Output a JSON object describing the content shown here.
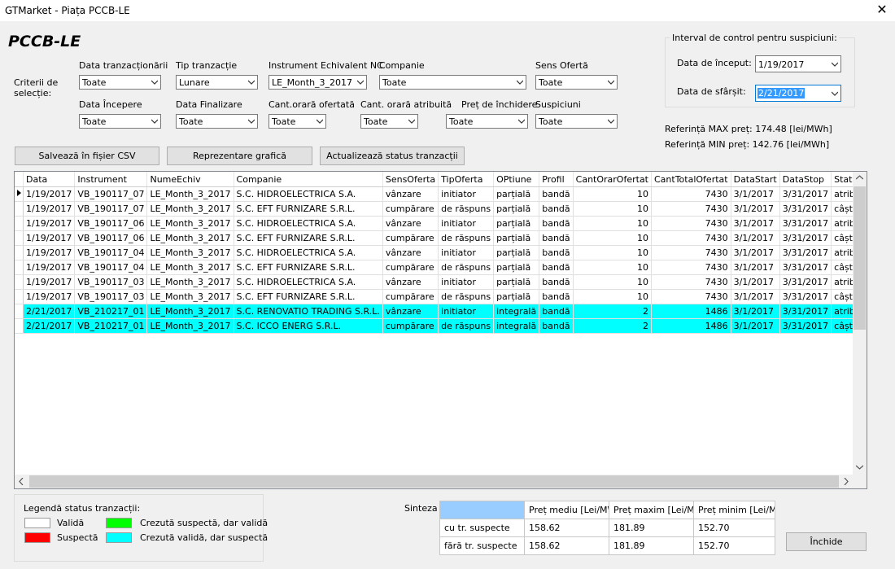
{
  "window": {
    "title": "GTMarket - Piața PCCB-LE",
    "close": "✕"
  },
  "app_title": "PCCB-LE",
  "criteria_label": "Criterii de selecție:",
  "filters": {
    "data_tranzactionarii": {
      "label": "Data tranzacționării",
      "value": "Toate"
    },
    "tip_tranzactie": {
      "label": "Tip tranzacție",
      "value": "Lunare"
    },
    "instrument": {
      "label": "Instrument Echivalent NC",
      "value": "LE_Month_3_2017"
    },
    "companie": {
      "label": "Companie",
      "value": "Toate"
    },
    "sens_oferta": {
      "label": "Sens Ofertă",
      "value": "Toate"
    },
    "data_incepere": {
      "label": "Data Începere",
      "value": "Toate"
    },
    "data_finalizare": {
      "label": "Data Finalizare",
      "value": "Toate"
    },
    "cant_orara_ofertata": {
      "label": "Cant.orară ofertată",
      "value": "Toate"
    },
    "cant_orara_atribuita": {
      "label": "Cant. orară atribuită",
      "value": "Toate"
    },
    "pret_inchidere": {
      "label": "Preț de închidere",
      "value": "Toate"
    },
    "suspiciuni": {
      "label": "Suspiciuni",
      "value": "Toate"
    }
  },
  "interval": {
    "title": "Interval de control pentru suspiciuni:",
    "start_label": "Data de început:",
    "start_value": "1/19/2017",
    "end_label": "Data de sfârșit:",
    "end_value": "2/21/2017"
  },
  "references": {
    "max": "Referință MAX preț: 174.48 [lei/MWh]",
    "min": "Referință MIN preț: 142.76 [lei/MWh]"
  },
  "buttons": {
    "save_csv": "Salvează în fișier CSV",
    "chart": "Reprezentare grafică",
    "update_status": "Actualizează status tranzacții",
    "close": "Închide"
  },
  "table": {
    "columns": [
      "Data",
      "Instrument",
      "NumeEchiv",
      "Companie",
      "SensOferta",
      "TipOferta",
      "OPtiune",
      "Profil",
      "CantOrarOfertat",
      "CantTotalOfertat",
      "DataStart",
      "DataStop",
      "StatusOferta"
    ],
    "rows": [
      [
        "1/19/2017",
        "VB_190117_07",
        "LE_Month_3_2017",
        "S.C. HIDROELECTRICA S.A.",
        "vânzare",
        "initiator",
        "parțială",
        "bandă",
        "10",
        "7430",
        "3/1/2017",
        "3/31/2017",
        "atribuită integral"
      ],
      [
        "1/19/2017",
        "VB_190117_07",
        "LE_Month_3_2017",
        "S.C. EFT FURNIZARE S.R.L.",
        "cumpărare",
        "de răspuns",
        "parțială",
        "bandă",
        "10",
        "7430",
        "3/1/2017",
        "3/31/2017",
        "câștigătoare integral"
      ],
      [
        "1/19/2017",
        "VB_190117_06",
        "LE_Month_3_2017",
        "S.C. HIDROELECTRICA S.A.",
        "vânzare",
        "initiator",
        "parțială",
        "bandă",
        "10",
        "7430",
        "3/1/2017",
        "3/31/2017",
        "atribuită integral"
      ],
      [
        "1/19/2017",
        "VB_190117_06",
        "LE_Month_3_2017",
        "S.C. EFT FURNIZARE S.R.L.",
        "cumpărare",
        "de răspuns",
        "parțială",
        "bandă",
        "10",
        "7430",
        "3/1/2017",
        "3/31/2017",
        "câștigătoare integral"
      ],
      [
        "1/19/2017",
        "VB_190117_04",
        "LE_Month_3_2017",
        "S.C. HIDROELECTRICA S.A.",
        "vânzare",
        "initiator",
        "parțială",
        "bandă",
        "10",
        "7430",
        "3/1/2017",
        "3/31/2017",
        "atribuită integral"
      ],
      [
        "1/19/2017",
        "VB_190117_04",
        "LE_Month_3_2017",
        "S.C. EFT FURNIZARE S.R.L.",
        "cumpărare",
        "de răspuns",
        "parțială",
        "bandă",
        "10",
        "7430",
        "3/1/2017",
        "3/31/2017",
        "câștigătoare integral"
      ],
      [
        "1/19/2017",
        "VB_190117_03",
        "LE_Month_3_2017",
        "S.C. HIDROELECTRICA S.A.",
        "vânzare",
        "initiator",
        "parțială",
        "bandă",
        "10",
        "7430",
        "3/1/2017",
        "3/31/2017",
        "atribuită integral"
      ],
      [
        "1/19/2017",
        "VB_190117_03",
        "LE_Month_3_2017",
        "S.C. EFT FURNIZARE S.R.L.",
        "cumpărare",
        "de răspuns",
        "parțială",
        "bandă",
        "10",
        "7430",
        "3/1/2017",
        "3/31/2017",
        "câștigătoare integral"
      ],
      [
        "2/21/2017",
        "VB_210217_01",
        "LE_Month_3_2017",
        "S.C. RENOVATIO TRADING S.R.L.",
        "vânzare",
        "initiator",
        "integrală",
        "bandă",
        "2",
        "1486",
        "3/1/2017",
        "3/31/2017",
        "atribuită integral"
      ],
      [
        "2/21/2017",
        "VB_210217_01",
        "LE_Month_3_2017",
        "S.C. ICCO ENERG S.R.L.",
        "cumpărare",
        "de răspuns",
        "integrală",
        "bandă",
        "2",
        "1486",
        "3/1/2017",
        "3/31/2017",
        "câștigătoare integral"
      ]
    ],
    "row_status": [
      "valid",
      "valid",
      "valid",
      "valid",
      "valid",
      "valid",
      "valid",
      "valid",
      "cyan",
      "cyan"
    ]
  },
  "legend": {
    "title": "Legendă status tranzacții:",
    "items": [
      {
        "label": "Validă",
        "color": "#ffffff"
      },
      {
        "label": "Suspectă",
        "color": "#ff0000"
      },
      {
        "label": "Crezută suspectă, dar validă",
        "color": "#00ff00"
      },
      {
        "label": "Crezută validă, dar suspectă",
        "color": "#00ffff"
      }
    ]
  },
  "sinteza": {
    "label": "Sinteza :",
    "headers": [
      "Preț mediu [Lei/MWh]",
      "Preț maxim [Lei/MWh]",
      "Preț minim [Lei/MWh]"
    ],
    "rows": [
      {
        "label": "cu tr. suspecte",
        "values": [
          "158.62",
          "181.89",
          "152.70"
        ]
      },
      {
        "label": "fără tr. suspecte",
        "values": [
          "158.62",
          "181.89",
          "152.70"
        ]
      }
    ]
  },
  "colors": {
    "header_cell": "#99ccff",
    "highlight": "#00ffff",
    "selection": "#3399ff"
  }
}
